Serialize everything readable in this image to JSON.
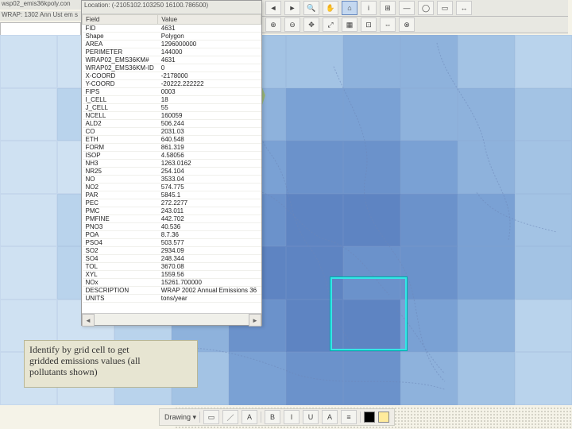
{
  "window": {
    "title_left": "wsp02_emis36kpoly.con",
    "title_sub": "WRAP: 1302 Ann Ust em s",
    "identify_header": "Location: (-2105102.103250 16100.786500)"
  },
  "toolbar_top": [
    "◄",
    "►",
    "🔍",
    "✋",
    "⌂",
    "i",
    "⊞",
    "—",
    "◯",
    "▭",
    "↔"
  ],
  "toolbar_second": [
    "⊕",
    "⊖",
    "✥",
    "⤢",
    "▦",
    "⊡",
    "⇔",
    "⊗"
  ],
  "identify": {
    "cols": [
      "Field",
      "Value"
    ],
    "rows": [
      [
        "FID",
        "4631"
      ],
      [
        "Shape",
        "Polygon"
      ],
      [
        "AREA",
        "1296000000"
      ],
      [
        "PERIMETER",
        "144000"
      ],
      [
        "WRAP02_EMS36KM#",
        "4631"
      ],
      [
        "WRAP02_EMS36KM-ID",
        "0"
      ],
      [
        "X-COORD",
        "-2178000"
      ],
      [
        "Y-COORD",
        "-20222.222222"
      ],
      [
        "FIPS",
        "0003"
      ],
      [
        "I_CELL",
        "18"
      ],
      [
        "J_CELL",
        "55"
      ],
      [
        "NCELL",
        "160059"
      ],
      [
        "ALD2",
        "506.244"
      ],
      [
        "CO",
        "2031.03"
      ],
      [
        "ETH",
        "640.548"
      ],
      [
        "FORM",
        "861.319"
      ],
      [
        "ISOP",
        "4.58056"
      ],
      [
        "NH3",
        "1263.0162"
      ],
      [
        "NR25",
        "254.104"
      ],
      [
        "NO",
        "3533.04"
      ],
      [
        "NO2",
        "574.775"
      ],
      [
        "PAR",
        "5845.1"
      ],
      [
        "PEC",
        "272.2277"
      ],
      [
        "PMC",
        "243.011"
      ],
      [
        "PMFINE",
        "442.702"
      ],
      [
        "PNO3",
        "40.536"
      ],
      [
        "POA",
        "8.7.36"
      ],
      [
        "PSO4",
        "503.577"
      ],
      [
        "SO2",
        "2934.09"
      ],
      [
        "SO4",
        "248.344"
      ],
      [
        "TOL",
        "3670.08"
      ],
      [
        "XYL",
        "1559.56"
      ],
      [
        "NOx",
        "15261.700000"
      ],
      [
        "DESCRIPTION",
        "WRAP 2002 Annual Emissions 36"
      ],
      [
        "UNITS",
        "tons/year"
      ]
    ]
  },
  "callout": {
    "line1": "Identify by grid cell to get",
    "line2": "gridded emissions values (all",
    "line3": "pollutants shown)"
  },
  "bottom_toolbar": {
    "label": "Drawing ▾",
    "format_items": [
      "B",
      "I",
      "U",
      "A",
      "≡"
    ]
  },
  "grid_shades": [
    [
      1,
      1,
      2,
      2,
      3,
      3,
      4,
      4,
      3,
      2
    ],
    [
      1,
      2,
      2,
      3,
      4,
      5,
      5,
      4,
      4,
      3
    ],
    [
      1,
      1,
      2,
      4,
      5,
      6,
      6,
      5,
      4,
      3
    ],
    [
      1,
      2,
      3,
      5,
      6,
      7,
      7,
      6,
      5,
      3
    ],
    [
      1,
      2,
      3,
      5,
      7,
      7,
      6,
      6,
      5,
      3
    ],
    [
      1,
      1,
      2,
      4,
      6,
      7,
      7,
      5,
      4,
      2
    ],
    [
      1,
      1,
      2,
      3,
      5,
      6,
      6,
      4,
      3,
      2
    ]
  ]
}
